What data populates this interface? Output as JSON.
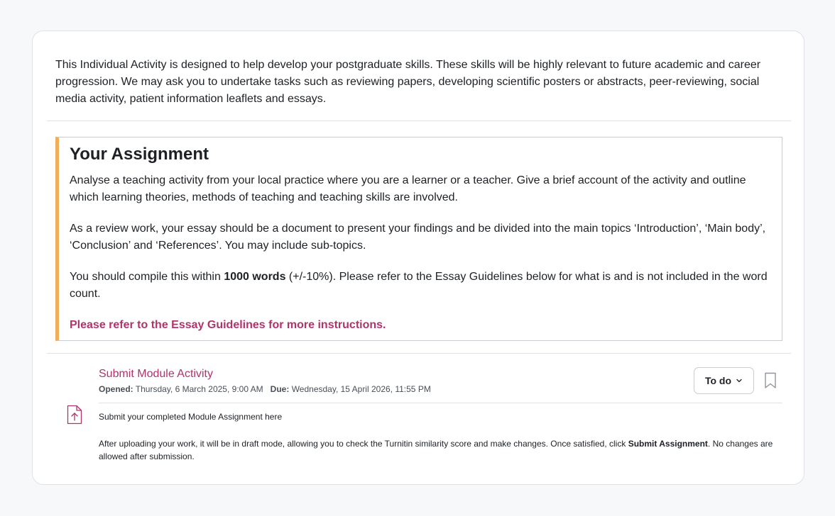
{
  "intro": {
    "text": "This Individual Activity is designed to help develop your postgraduate skills. These skills will be highly relevant to future academic and career progression. We may ask you to undertake tasks such as reviewing papers, developing scientific posters or abstracts, peer-reviewing, social media activity, patient information leaflets and essays."
  },
  "assignment": {
    "heading": "Your Assignment",
    "para1": "Analyse a teaching activity from your local practice where you are a learner or a teacher. Give a brief account of the activity and outline which learning theories, methods of teaching and teaching skills are involved.",
    "para2": "As a review work, your essay should be a document to present your findings and be divided into the main topics ‘Introduction’, ‘Main body’, ‘Conclusion’ and ‘References’. You may include sub-topics.",
    "para3_pre": "You should compile this within ",
    "para3_bold": "1000 words",
    "para3_post": " (+/-10%). Please refer to the Essay Guidelines below for what is and is not included in the word count.",
    "reference_note": "Please refer to the Essay Guidelines for more instructions.",
    "accent_color": "#f0ad5a"
  },
  "activity": {
    "icon": "file-upload-icon",
    "title": "Submit Module Activity",
    "opened_label": "Opened:",
    "opened_value": "Thursday, 6 March 2025, 9:00 AM",
    "due_label": "Due:",
    "due_value": "Wednesday, 15 April 2026, 11:55 PM",
    "status_button": "To do",
    "description1": "Submit your completed Module Assignment here",
    "description2_pre": "After uploading your work, it will be in draft mode, allowing you to check the Turnitin similarity score and make changes. Once satisfied, click ",
    "description2_bold": "Submit Assignment",
    "description2_post": ". No changes are allowed after submission.",
    "link_color": "#b0336c"
  }
}
